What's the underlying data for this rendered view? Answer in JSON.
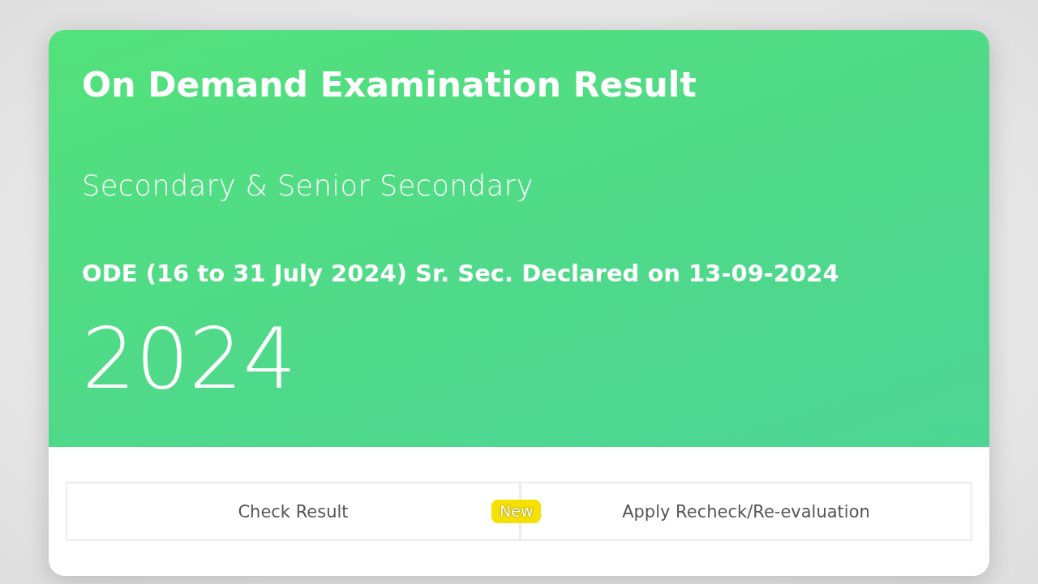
{
  "header": {
    "title": "On Demand Examination Result",
    "subtitle": "Secondary & Senior Secondary",
    "announcement": "ODE (16 to 31 July 2024) Sr. Sec. Declared on 13-09-2024",
    "year": "2024"
  },
  "actions": [
    {
      "label": "Check Result"
    },
    {
      "label": "Apply Recheck/Re-evaluation",
      "badge": "New"
    }
  ]
}
